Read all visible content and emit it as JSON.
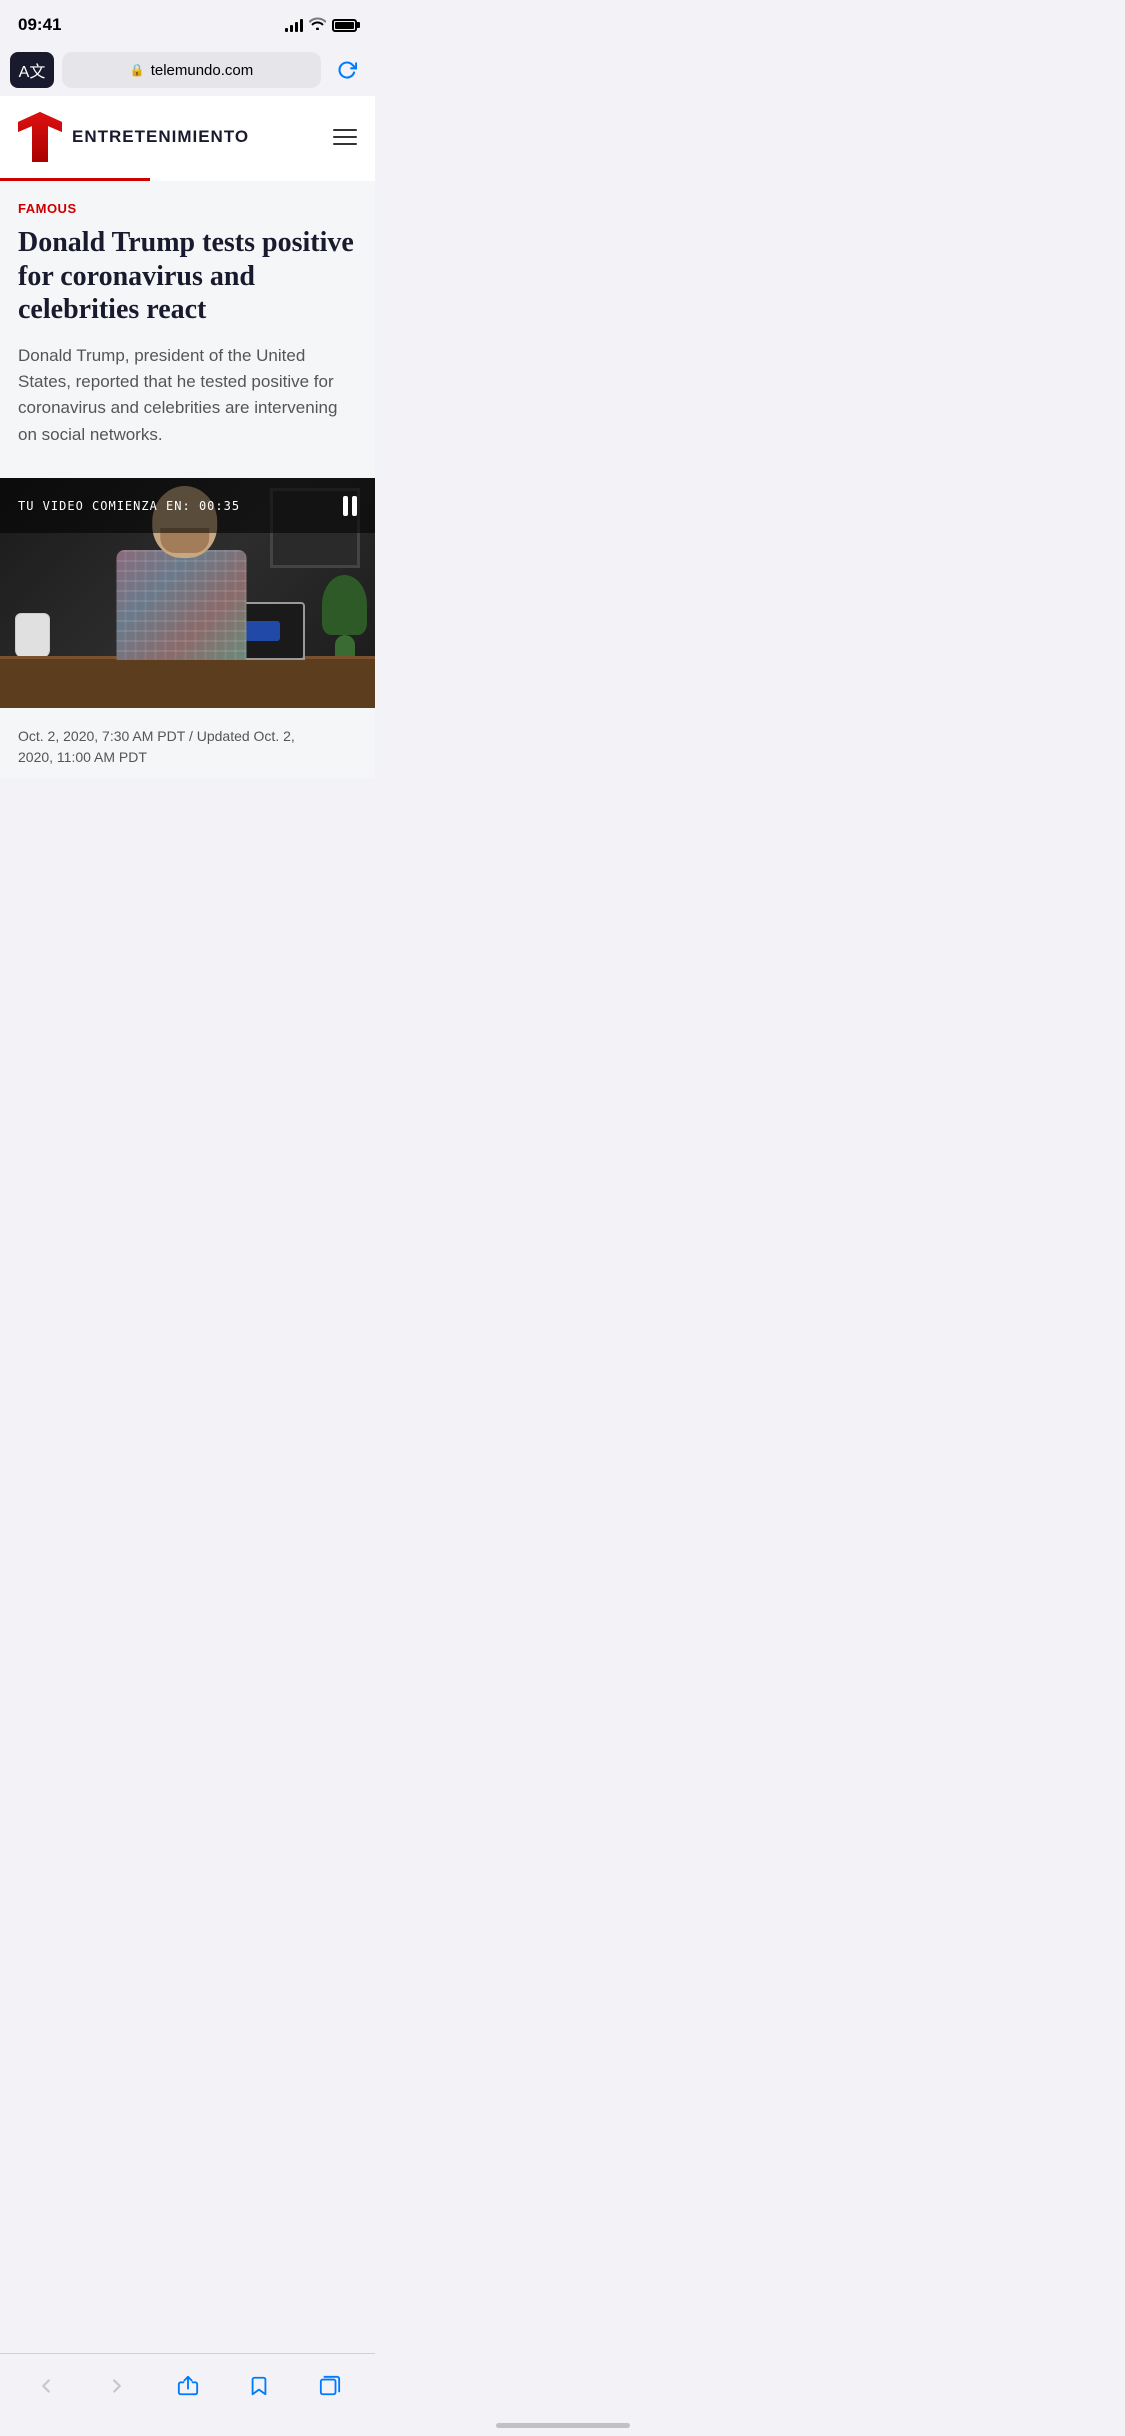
{
  "statusBar": {
    "time": "09:41",
    "url": "telemundo.com"
  },
  "browser": {
    "url": "telemundo.com",
    "refreshLabel": "↺"
  },
  "header": {
    "siteName": "ENTRETENIMIENTO",
    "logoAlt": "Telemundo T logo"
  },
  "article": {
    "category": "FAMOUS",
    "title": "Donald Trump tests positive for coronavirus and celebrities react",
    "description": "Donald Trump, president of the United States, reported that he tested positive for coronavirus and celebrities are intervening on social networks.",
    "date": "Oct. 2, 2020, 7:30 AM PDT / Updated Oct. 2,",
    "dateSecondLine": "2020, 11:00 AM PDT"
  },
  "video": {
    "countdown": "TU VIDEO COMIENZA EN: 00:35"
  },
  "bottomNav": {
    "back": "‹",
    "forward": "›",
    "share": "share",
    "bookmarks": "bookmarks",
    "tabs": "tabs"
  }
}
